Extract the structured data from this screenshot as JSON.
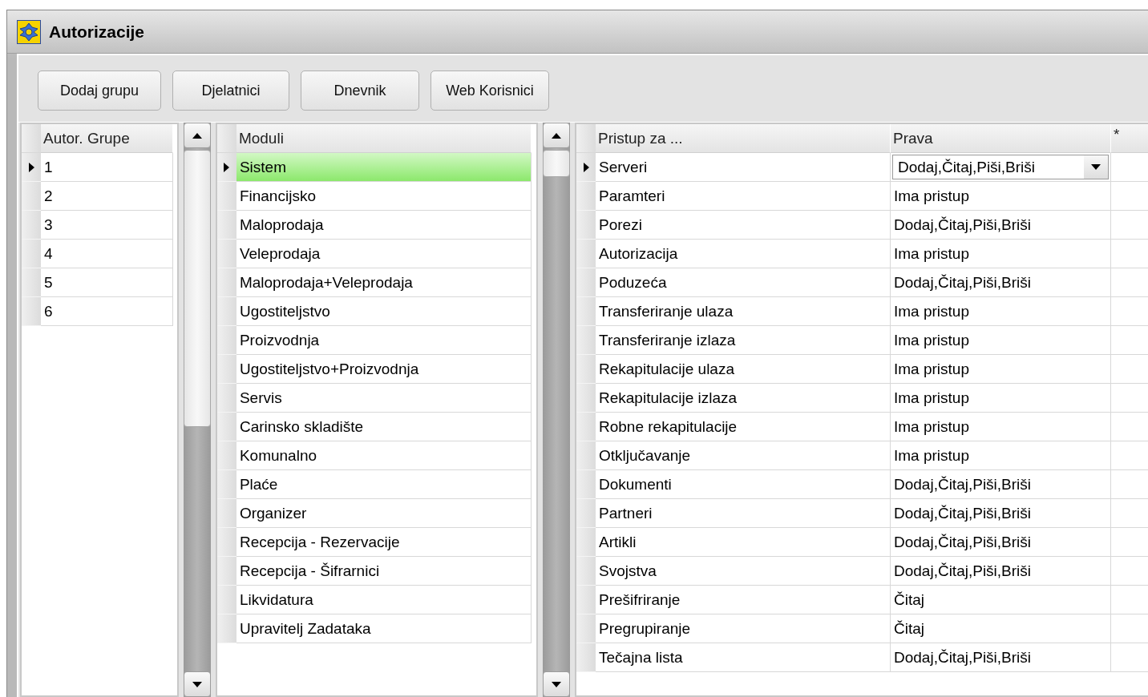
{
  "window": {
    "title": "Autorizacije"
  },
  "toolbar": {
    "buttons": [
      "Dodaj grupu",
      "Djelatnici",
      "Dnevnik",
      "Web Korisnici"
    ]
  },
  "groups": {
    "column": "Autor. Grupe",
    "rows": [
      {
        "value": "1",
        "current": true
      },
      {
        "value": "2",
        "current": false
      },
      {
        "value": "3",
        "current": false
      },
      {
        "value": "4",
        "current": false
      },
      {
        "value": "5",
        "current": false
      },
      {
        "value": "6",
        "current": false
      }
    ]
  },
  "modules": {
    "column": "Moduli",
    "rows": [
      {
        "value": "Sistem",
        "current": true,
        "selected": true
      },
      {
        "value": "Financijsko",
        "current": false,
        "selected": false
      },
      {
        "value": "Maloprodaja",
        "current": false,
        "selected": false
      },
      {
        "value": "Veleprodaja",
        "current": false,
        "selected": false
      },
      {
        "value": "Maloprodaja+Veleprodaja",
        "current": false,
        "selected": false
      },
      {
        "value": "Ugostiteljstvo",
        "current": false,
        "selected": false
      },
      {
        "value": "Proizvodnja",
        "current": false,
        "selected": false
      },
      {
        "value": "Ugostiteljstvo+Proizvodnja",
        "current": false,
        "selected": false
      },
      {
        "value": "Servis",
        "current": false,
        "selected": false
      },
      {
        "value": "Carinsko skladište",
        "current": false,
        "selected": false
      },
      {
        "value": "Komunalno",
        "current": false,
        "selected": false
      },
      {
        "value": "Plaće",
        "current": false,
        "selected": false
      },
      {
        "value": "Organizer",
        "current": false,
        "selected": false
      },
      {
        "value": "Recepcija - Rezervacije",
        "current": false,
        "selected": false
      },
      {
        "value": "Recepcija - Šifrarnici",
        "current": false,
        "selected": false
      },
      {
        "value": "Likvidatura",
        "current": false,
        "selected": false
      },
      {
        "value": "Upravitelj Zadataka",
        "current": false,
        "selected": false
      }
    ]
  },
  "permissions": {
    "columns": [
      "Pristup za ...",
      "Prava",
      "*"
    ],
    "rows": [
      {
        "access": "Serveri",
        "rights": "Dodaj,Čitaj,Piši,Briši",
        "current": true,
        "kind": "dropdown"
      },
      {
        "access": "Paramteri",
        "rights": "Ima pristup",
        "current": false,
        "kind": "text"
      },
      {
        "access": "Porezi",
        "rights": "Dodaj,Čitaj,Piši,Briši",
        "current": false,
        "kind": "text"
      },
      {
        "access": "Autorizacija",
        "rights": "Ima pristup",
        "current": false,
        "kind": "text"
      },
      {
        "access": "Poduzeća",
        "rights": "Dodaj,Čitaj,Piši,Briši",
        "current": false,
        "kind": "text"
      },
      {
        "access": "Transferiranje ulaza",
        "rights": "Ima pristup",
        "current": false,
        "kind": "text"
      },
      {
        "access": "Transferiranje izlaza",
        "rights": "Ima pristup",
        "current": false,
        "kind": "text"
      },
      {
        "access": "Rekapitulacije ulaza",
        "rights": "Ima pristup",
        "current": false,
        "kind": "text"
      },
      {
        "access": "Rekapitulacije izlaza",
        "rights": "Ima pristup",
        "current": false,
        "kind": "text"
      },
      {
        "access": "Robne rekapitulacije",
        "rights": "Ima pristup",
        "current": false,
        "kind": "text"
      },
      {
        "access": "Otključavanje",
        "rights": "Ima pristup",
        "current": false,
        "kind": "text"
      },
      {
        "access": "Dokumenti",
        "rights": "Dodaj,Čitaj,Piši,Briši",
        "current": false,
        "kind": "text"
      },
      {
        "access": "Partneri",
        "rights": "Dodaj,Čitaj,Piši,Briši",
        "current": false,
        "kind": "text"
      },
      {
        "access": "Artikli",
        "rights": "Dodaj,Čitaj,Piši,Briši",
        "current": false,
        "kind": "text"
      },
      {
        "access": "Svojstva",
        "rights": "Dodaj,Čitaj,Piši,Briši",
        "current": false,
        "kind": "text"
      },
      {
        "access": "Prešifriranje",
        "rights": "Čitaj",
        "current": false,
        "kind": "text"
      },
      {
        "access": "Pregrupiranje",
        "rights": "Čitaj",
        "current": false,
        "kind": "text"
      },
      {
        "access": "Tečajna lista",
        "rights": "Dodaj,Čitaj,Piši,Briši",
        "current": false,
        "kind": "text"
      }
    ]
  }
}
